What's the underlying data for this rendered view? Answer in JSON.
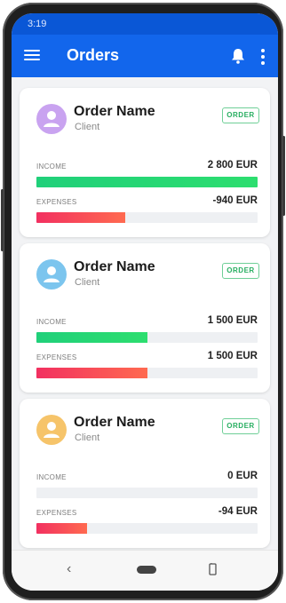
{
  "status_bar": {
    "time": "3:19"
  },
  "app_bar": {
    "title": "Orders"
  },
  "orders": [
    {
      "name": "Order Name",
      "client": "Client",
      "badge": "ORDER",
      "avatar_color": "#c9a3f0",
      "income_label": "INCOME",
      "income_value": "2 800 EUR",
      "income_fraction": 1.0,
      "expenses_label": "EXPENSES",
      "expenses_value": "-940 EUR",
      "expenses_fraction": 0.4
    },
    {
      "name": "Order Name",
      "client": "Client",
      "badge": "ORDER",
      "avatar_color": "#7cc5ee",
      "income_label": "INCOME",
      "income_value": "1 500 EUR",
      "income_fraction": 0.5,
      "expenses_label": "EXPENSES",
      "expenses_value": "1 500 EUR",
      "expenses_fraction": 0.5
    },
    {
      "name": "Order Name",
      "client": "Client",
      "badge": "ORDER",
      "avatar_color": "#f6c46a",
      "income_label": "INCOME",
      "income_value": "0 EUR",
      "income_fraction": 0.0,
      "expenses_label": "EXPENSES",
      "expenses_value": "-94 EUR",
      "expenses_fraction": 0.23
    }
  ],
  "colors": {
    "app_bar": "#1266ec",
    "status_bar": "#0a57d6",
    "income_bar": "#20d07a",
    "expenses_bar": "#f23060",
    "badge": "#27ae60"
  },
  "icons": {
    "menu": "hamburger-icon",
    "notifications": "bell-icon",
    "more": "more-vertical-icon",
    "avatar": "person-icon",
    "back": "back-icon",
    "home": "home-pill-icon",
    "rotate": "rotate-icon"
  }
}
